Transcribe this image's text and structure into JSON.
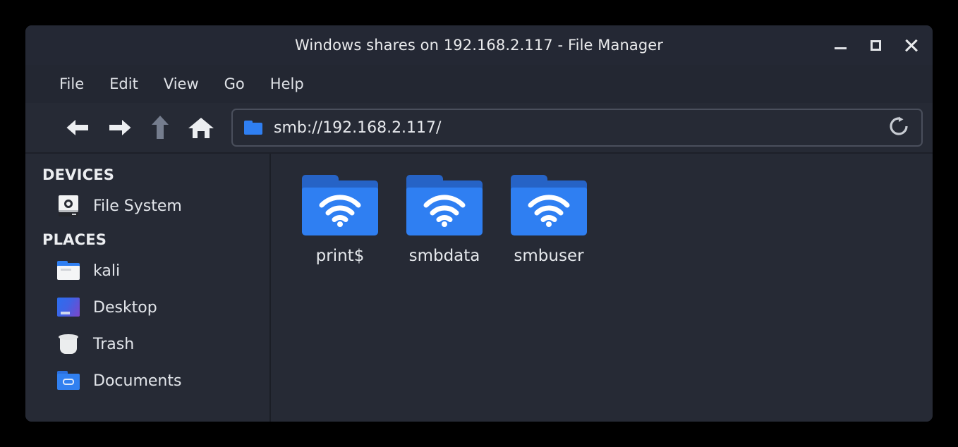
{
  "window": {
    "title": "Windows shares on 192.168.2.117 - File Manager",
    "controls": {
      "minimize": "minimize-button",
      "maximize": "maximize-button",
      "close": "close-button"
    }
  },
  "menubar": {
    "items": [
      {
        "label": "File"
      },
      {
        "label": "Edit"
      },
      {
        "label": "View"
      },
      {
        "label": "Go"
      },
      {
        "label": "Help"
      }
    ]
  },
  "toolbar": {
    "back": "back-button",
    "forward": "forward-button",
    "up": "up-button",
    "home": "home-button",
    "reload": "reload-button",
    "address": {
      "value": "smb://192.168.2.117/",
      "placeholder": "smb://192.168.2.117/",
      "icon": "folder-icon"
    }
  },
  "sidebar": {
    "sections": [
      {
        "header": "DEVICES",
        "items": [
          {
            "label": "File System",
            "icon": "drive-icon"
          }
        ]
      },
      {
        "header": "PLACES",
        "items": [
          {
            "label": "kali",
            "icon": "home-folder-icon"
          },
          {
            "label": "Desktop",
            "icon": "desktop-icon"
          },
          {
            "label": "Trash",
            "icon": "trash-icon"
          },
          {
            "label": "Documents",
            "icon": "documents-folder-icon"
          }
        ]
      }
    ]
  },
  "content": {
    "shares": [
      {
        "name": "print$",
        "icon": "network-share-folder-icon"
      },
      {
        "name": "smbdata",
        "icon": "network-share-folder-icon"
      },
      {
        "name": "smbuser",
        "icon": "network-share-folder-icon"
      }
    ]
  },
  "colors": {
    "window_bg": "#262a35",
    "titlebar_bg": "#242834",
    "text": "#e4e7eb",
    "folder_blue": "#2f7ff2",
    "folder_blue_dark": "#2663c6",
    "border": "#4a4f5c",
    "desktop_accent": "#7d46c9"
  }
}
